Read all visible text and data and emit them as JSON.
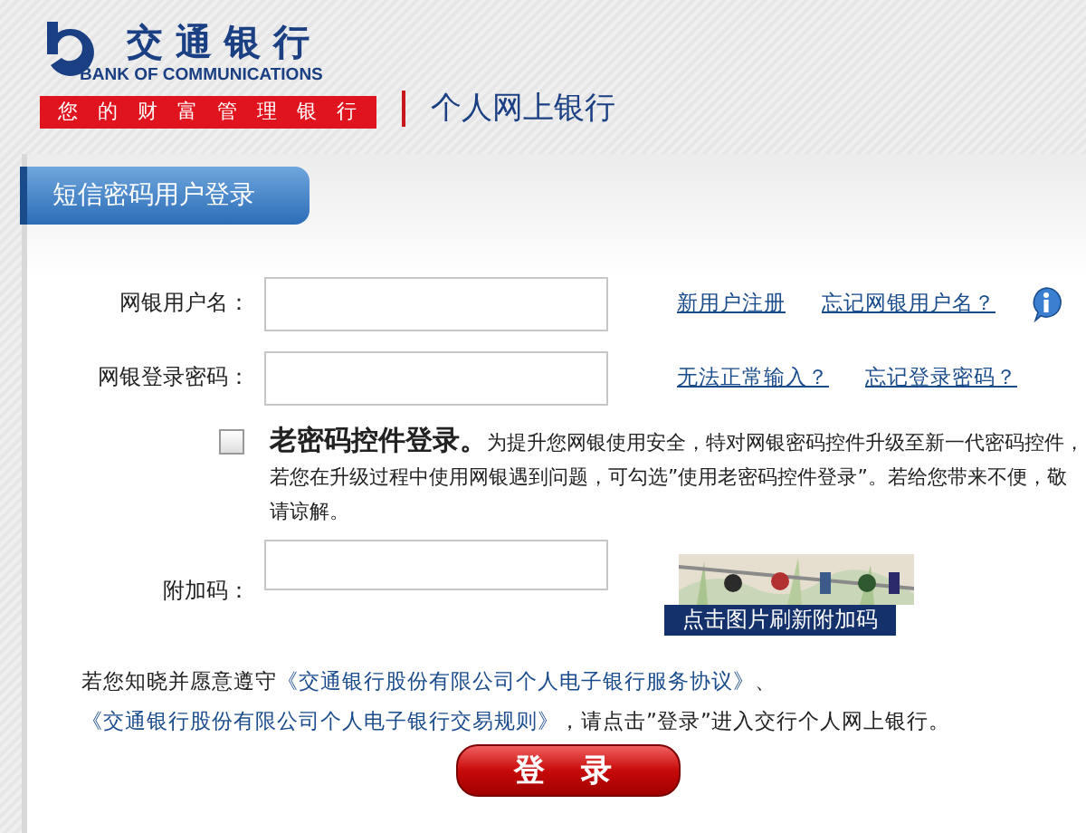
{
  "header": {
    "bank_name": "交通银行",
    "bank_name_en": "BANK OF COMMUNICATIONS",
    "slogan": "您的财富管理银行",
    "product": "个人网上银行"
  },
  "tab": {
    "label": "短信密码用户登录",
    "selected": true
  },
  "fields": [
    {
      "label": "网银用户名：",
      "links": [
        "新用户注册",
        "忘记网银用户名？"
      ],
      "info": true
    },
    {
      "label": "网银登录密码：",
      "links": [
        "无法正常输入？",
        "忘记登录密码？"
      ],
      "info": false
    }
  ],
  "old_control": {
    "checked": false,
    "text": "**老密码控件登录。**为提升您网银使用安全，特对网银密码控件升级至新一代密码控件，若您在升级过程中使用网银遇到问题，可勾选”使用老密码控件登录”。若给您带来不便，敬请谅解。"
  },
  "captcha": {
    "label": "附加码：",
    "refresh_text": "点击图片刷新附加码"
  },
  "agreement": [
    {
      "kind": "text",
      "text": "若您知晓并愿意遵守"
    },
    {
      "kind": "link",
      "text": "《交通银行股份有限公司个人电子银行服务协议》"
    },
    {
      "kind": "text",
      "text": "、"
    },
    {
      "kind": "link",
      "text": "《交通银行股份有限公司个人电子银行交易规则》"
    },
    {
      "kind": "text",
      "text": "，请点击”登录”进入交行个人网上银行。"
    }
  ],
  "login_button": "登录"
}
